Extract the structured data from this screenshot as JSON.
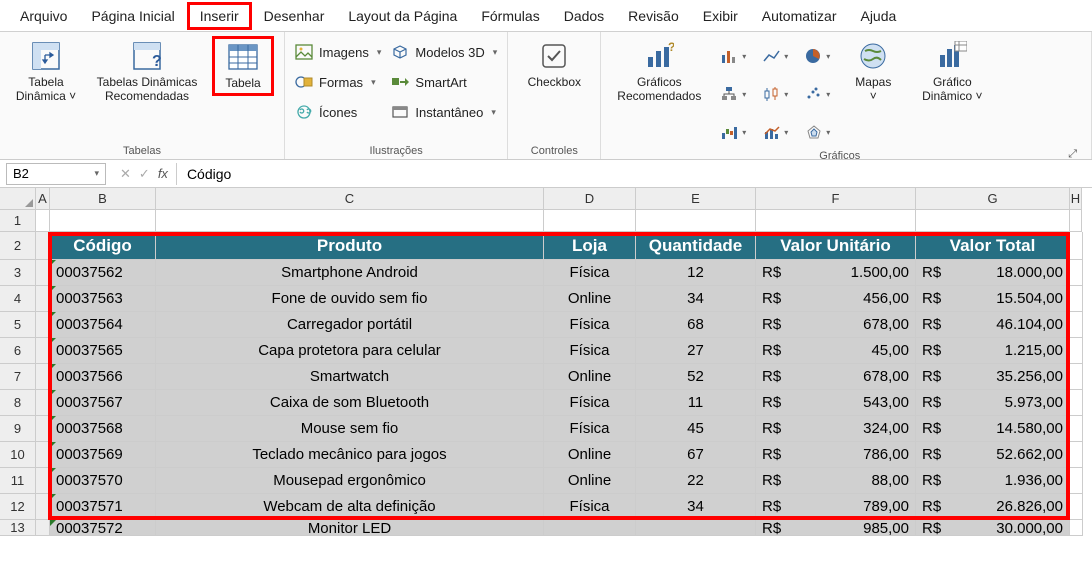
{
  "menu": {
    "items": [
      "Arquivo",
      "Página Inicial",
      "Inserir",
      "Desenhar",
      "Layout da Página",
      "Fórmulas",
      "Dados",
      "Revisão",
      "Exibir",
      "Automatizar",
      "Ajuda"
    ],
    "active_index": 2
  },
  "ribbon": {
    "tabelas": {
      "label": "Tabelas",
      "pivot": "Tabela\nDinâmica",
      "recommended": "Tabelas Dinâmicas\nRecomendadas",
      "table": "Tabela"
    },
    "ilustracoes": {
      "label": "Ilustrações",
      "imagens": "Imagens",
      "formas": "Formas",
      "icones": "Ícones",
      "modelos3d": "Modelos 3D",
      "smartart": "SmartArt",
      "instantaneo": "Instantâneo"
    },
    "controles": {
      "label": "Controles",
      "checkbox": "Checkbox"
    },
    "graficos": {
      "label": "Gráficos",
      "recomendados": "Gráficos\nRecomendados",
      "mapas": "Mapas",
      "dinamico": "Gráfico\nDinâmico"
    }
  },
  "formula_bar": {
    "name_box": "B2",
    "formula": "Código"
  },
  "columns": [
    "A",
    "B",
    "C",
    "D",
    "E",
    "F",
    "G",
    "H"
  ],
  "row_numbers": [
    1,
    2,
    3,
    4,
    5,
    6,
    7,
    8,
    9,
    10,
    11,
    12,
    13
  ],
  "chart_data": {
    "type": "table",
    "headers": [
      "Código",
      "Produto",
      "Loja",
      "Quantidade",
      "Valor Unitário",
      "Valor Total"
    ],
    "rows": [
      {
        "codigo": "00037562",
        "produto": "Smartphone Android",
        "loja": "Física",
        "qtd": 12,
        "unit": "1.500,00",
        "total": "18.000,00"
      },
      {
        "codigo": "00037563",
        "produto": "Fone de ouvido sem fio",
        "loja": "Online",
        "qtd": 34,
        "unit": "456,00",
        "total": "15.504,00"
      },
      {
        "codigo": "00037564",
        "produto": "Carregador portátil",
        "loja": "Física",
        "qtd": 68,
        "unit": "678,00",
        "total": "46.104,00"
      },
      {
        "codigo": "00037565",
        "produto": "Capa protetora para celular",
        "loja": "Física",
        "qtd": 27,
        "unit": "45,00",
        "total": "1.215,00"
      },
      {
        "codigo": "00037566",
        "produto": "Smartwatch",
        "loja": "Online",
        "qtd": 52,
        "unit": "678,00",
        "total": "35.256,00"
      },
      {
        "codigo": "00037567",
        "produto": "Caixa de som Bluetooth",
        "loja": "Física",
        "qtd": 11,
        "unit": "543,00",
        "total": "5.973,00"
      },
      {
        "codigo": "00037568",
        "produto": "Mouse sem fio",
        "loja": "Física",
        "qtd": 45,
        "unit": "324,00",
        "total": "14.580,00"
      },
      {
        "codigo": "00037569",
        "produto": "Teclado mecânico para jogos",
        "loja": "Online",
        "qtd": 67,
        "unit": "786,00",
        "total": "52.662,00"
      },
      {
        "codigo": "00037570",
        "produto": "Mousepad ergonômico",
        "loja": "Online",
        "qtd": 22,
        "unit": "88,00",
        "total": "1.936,00"
      },
      {
        "codigo": "00037571",
        "produto": "Webcam de alta definição",
        "loja": "Física",
        "qtd": 34,
        "unit": "789,00",
        "total": "26.826,00"
      }
    ],
    "partial_row": {
      "codigo": "00037572",
      "produto": "Monitor LED",
      "unit": "985,00",
      "total": "30.000,00"
    },
    "currency": "R$"
  }
}
